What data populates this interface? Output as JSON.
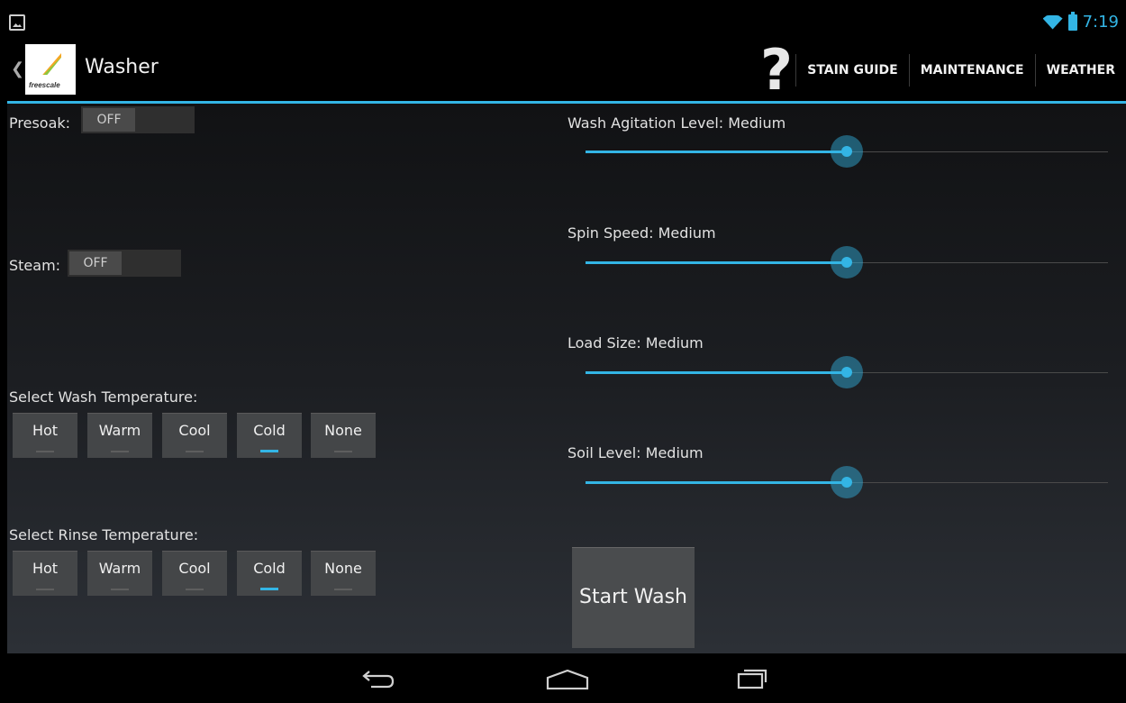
{
  "status_bar": {
    "time": "7:19"
  },
  "action_bar": {
    "title": "Washer",
    "logo_text": "freescale",
    "help_glyph": "?",
    "actions": [
      "STAIN GUIDE",
      "MAINTENANCE",
      "WEATHER"
    ]
  },
  "presoak": {
    "label": "Presoak:",
    "state": "OFF"
  },
  "steam": {
    "label": "Steam:",
    "state": "OFF"
  },
  "wash_temp": {
    "label": "Select Wash Temperature:",
    "options": [
      "Hot",
      "Warm",
      "Cool",
      "Cold",
      "None"
    ],
    "selected": "Cold"
  },
  "rinse_temp": {
    "label": "Select Rinse Temperature:",
    "options": [
      "Hot",
      "Warm",
      "Cool",
      "Cold",
      "None"
    ],
    "selected": "Cold"
  },
  "sliders": [
    {
      "label": "Wash Agitation Level: Medium",
      "level": 0.5
    },
    {
      "label": "Spin Speed: Medium",
      "level": 0.5
    },
    {
      "label": "Load Size: Medium",
      "level": 0.5
    },
    {
      "label": "Soil Level: Medium",
      "level": 0.5
    }
  ],
  "start_button": "Start Wash",
  "colors": {
    "accent": "#33b5e5",
    "background": "#000000"
  }
}
